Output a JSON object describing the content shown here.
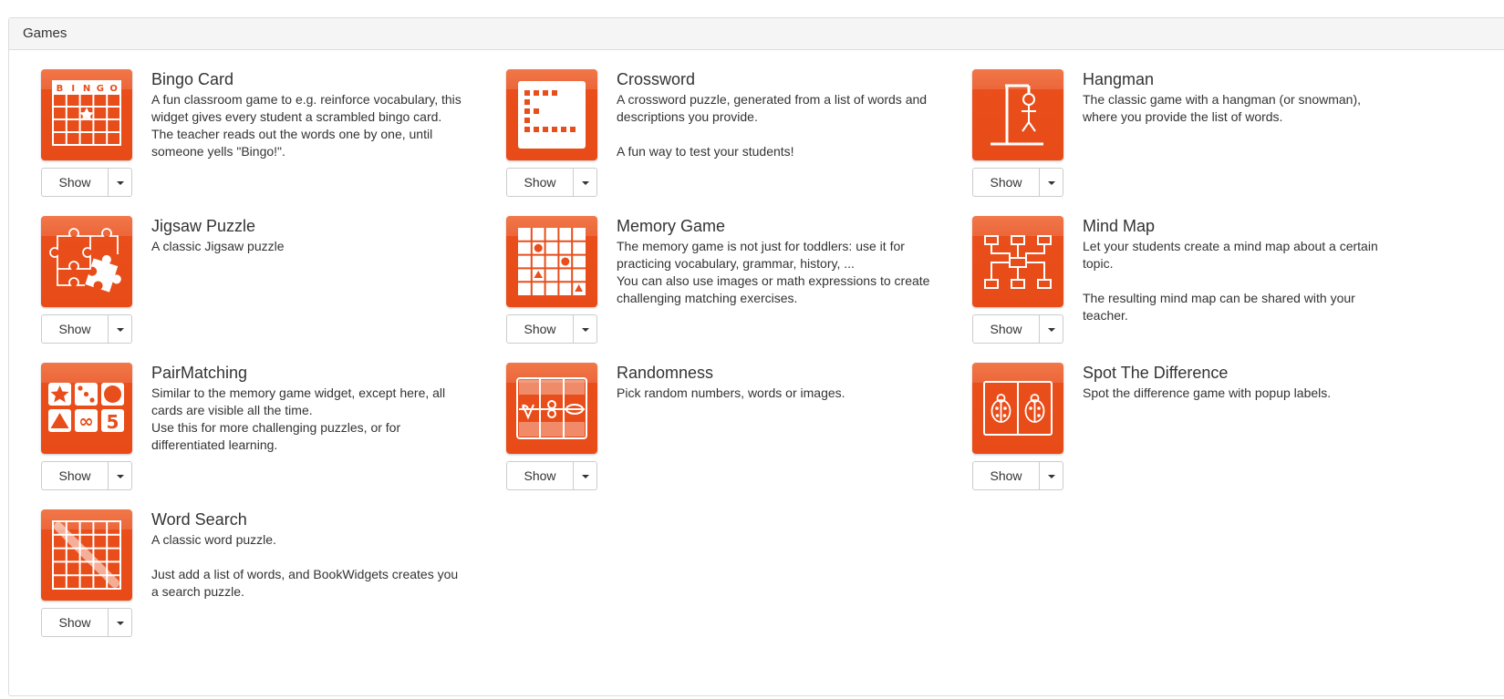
{
  "panel": {
    "title": "Games"
  },
  "widgets": [
    {
      "title": "Bingo Card",
      "description": "A fun classroom game to e.g. reinforce vocabulary, this widget gives every student a scrambled bingo card.\nThe teacher reads out the words one by one, until someone yells \"Bingo!\".",
      "show_label": "Show",
      "icon": "bingo-card-icon",
      "bingo_letters": "BINGO"
    },
    {
      "title": "Crossword",
      "description": "A crossword puzzle, generated from a list of words and descriptions you provide.\n\nA fun way to test your students!",
      "show_label": "Show",
      "icon": "crossword-icon"
    },
    {
      "title": "Hangman",
      "description": "The classic game with a hangman (or snowman), where you provide the list of words.",
      "show_label": "Show",
      "icon": "hangman-icon"
    },
    {
      "title": "Jigsaw Puzzle",
      "description": "A classic Jigsaw puzzle",
      "show_label": "Show",
      "icon": "jigsaw-puzzle-icon"
    },
    {
      "title": "Memory Game",
      "description": "The memory game is not just for toddlers: use it for practicing vocabulary, grammar, history, ...\nYou can also use images or math expressions to create challenging matching exercises.",
      "show_label": "Show",
      "icon": "memory-game-icon"
    },
    {
      "title": "Mind Map",
      "description": "Let your students create a mind map about a certain topic.\n\nThe resulting mind map can be shared with your teacher.",
      "show_label": "Show",
      "icon": "mind-map-icon"
    },
    {
      "title": "PairMatching",
      "description": "Similar to the memory game widget, except here, all cards are visible all the time.\nUse this for more challenging puzzles, or for differentiated learning.",
      "show_label": "Show",
      "icon": "pair-matching-icon",
      "tile_text": [
        "∞",
        "5"
      ]
    },
    {
      "title": "Randomness",
      "description": "Pick random numbers, words or images.",
      "show_label": "Show",
      "icon": "randomness-icon"
    },
    {
      "title": "Spot The Difference",
      "description": "Spot the difference game with popup labels.",
      "show_label": "Show",
      "icon": "spot-the-difference-icon"
    },
    {
      "title": "Word Search",
      "description": "A classic word puzzle.\n\nJust add a list of words, and BookWidgets creates you a search puzzle.",
      "show_label": "Show",
      "icon": "word-search-icon"
    }
  ],
  "colors": {
    "accent": "#e84e1b",
    "border": "#dddddd",
    "heading_bg": "#f5f5f5",
    "text": "#333333"
  }
}
